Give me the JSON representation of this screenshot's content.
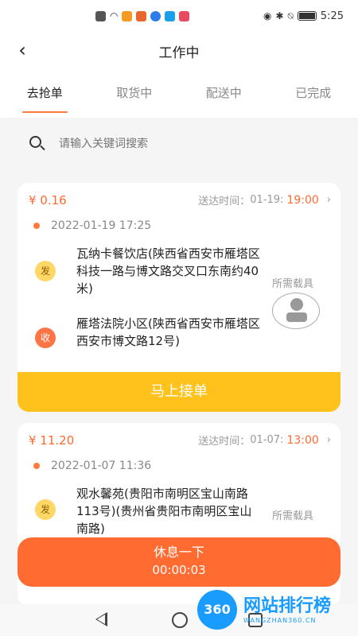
{
  "status_bar": {
    "time": "5:25"
  },
  "header": {
    "title": "工作中"
  },
  "tabs": [
    {
      "label": "去抢单",
      "active": true
    },
    {
      "label": "取货中",
      "active": false
    },
    {
      "label": "配送中",
      "active": false
    },
    {
      "label": "已完成",
      "active": false
    }
  ],
  "search": {
    "placeholder": "请输入关键词搜索"
  },
  "orders": [
    {
      "price": "¥ 0.16",
      "eta_label": "送达时间：",
      "eta_date": "01-19:",
      "eta_time": "19:00",
      "created": "2022-01-19 17:25",
      "sender_badge": "发",
      "sender_address": "瓦纳卡餐饮店(陕西省西安市雁塔区科技一路与博文路交叉口东南约40米)",
      "receiver_badge": "收",
      "receiver_address": "雁塔法院小区(陕西省西安市雁塔区西安市博文路12号)",
      "tool_label": "所需载具",
      "accept_label": "马上接单"
    },
    {
      "price": "¥ 11.20",
      "eta_label": "送达时间：",
      "eta_date": "01-07:",
      "eta_time": "13:00",
      "created": "2022-01-07 11:36",
      "sender_badge": "发",
      "sender_address": "观水馨苑(贵阳市南明区宝山南路113号)(贵州省贵阳市南明区宝山南路)",
      "tool_label": "所需载具"
    }
  ],
  "rest_button": {
    "label": "休息一下",
    "timer": "00:00:03"
  },
  "watermark": {
    "badge": "360",
    "title": "网站排行榜",
    "url": "WANGZHAN360.CN"
  },
  "colors": {
    "accent": "#ff6b30",
    "accept": "#ffc21c",
    "send_badge": "#ffd766",
    "recv_badge": "#ff7447"
  }
}
